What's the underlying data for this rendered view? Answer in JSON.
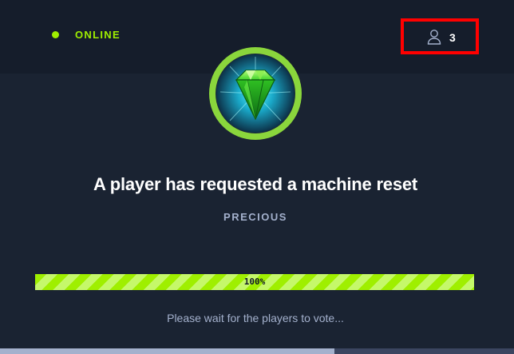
{
  "header": {
    "status_label": "ONLINE",
    "status_color": "#9fef00",
    "player_icon": "user-icon",
    "player_count": "3"
  },
  "badge": {
    "icon": "emerald-gem-icon"
  },
  "dialog": {
    "title": "A player has requested a machine reset",
    "machine_name": "PRECIOUS",
    "progress_percent": 100,
    "progress_label": "100%",
    "wait_message": "Please wait for the players to vote..."
  },
  "timer_bar": {
    "fill_fraction": 0.65
  },
  "colors": {
    "accent": "#9fef00",
    "background": "#1a2332",
    "topbar": "#151d2b",
    "muted_text": "#a4b1cd",
    "highlight_box": "#ff0000"
  }
}
